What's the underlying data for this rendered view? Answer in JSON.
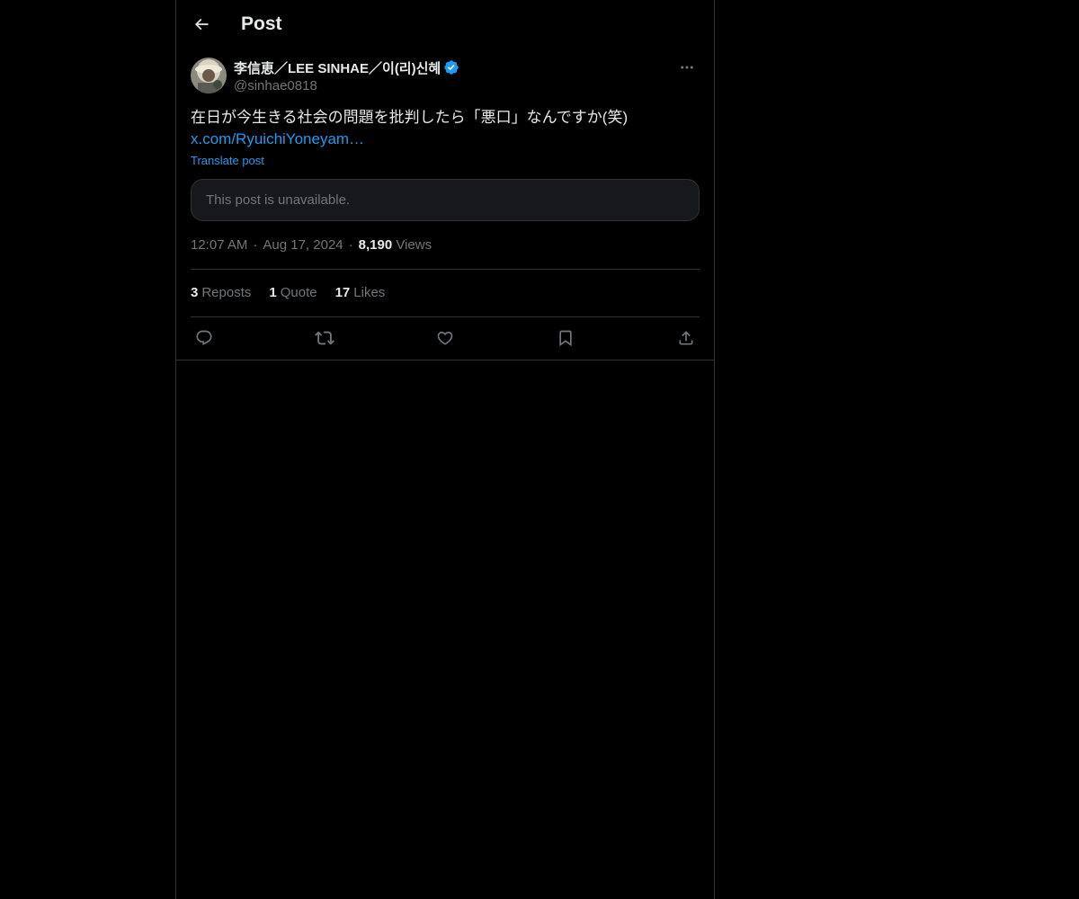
{
  "header": {
    "title": "Post",
    "back_icon": "arrow-left-icon"
  },
  "post": {
    "author": {
      "display_name": "李信恵／LEE SINHAE／이(리)신혜",
      "handle": "@sinhae0818",
      "verified": true,
      "avatar_icon": "avatar"
    },
    "text": "在日が今生きる社会の問題を批判したら「悪口」なんですか(笑)",
    "link": "x.com/RyuichiYoneyam…",
    "translate_label": "Translate post",
    "quoted_unavailable": "This post is unavailable.",
    "time": "12:07 AM",
    "date": "Aug 17, 2024",
    "views_count": "8,190",
    "views_label": "Views",
    "stats": {
      "reposts_count": "3",
      "reposts_label": "Reposts",
      "quotes_count": "1",
      "quotes_label": "Quote",
      "likes_count": "17",
      "likes_label": "Likes"
    },
    "actions": [
      "reply-icon",
      "repost-icon",
      "like-icon",
      "bookmark-icon",
      "share-icon"
    ]
  },
  "colors": {
    "background": "#000000",
    "text": "#e7e9ea",
    "muted": "#71767b",
    "accent": "#1d9bf0",
    "border": "#2f3336"
  }
}
